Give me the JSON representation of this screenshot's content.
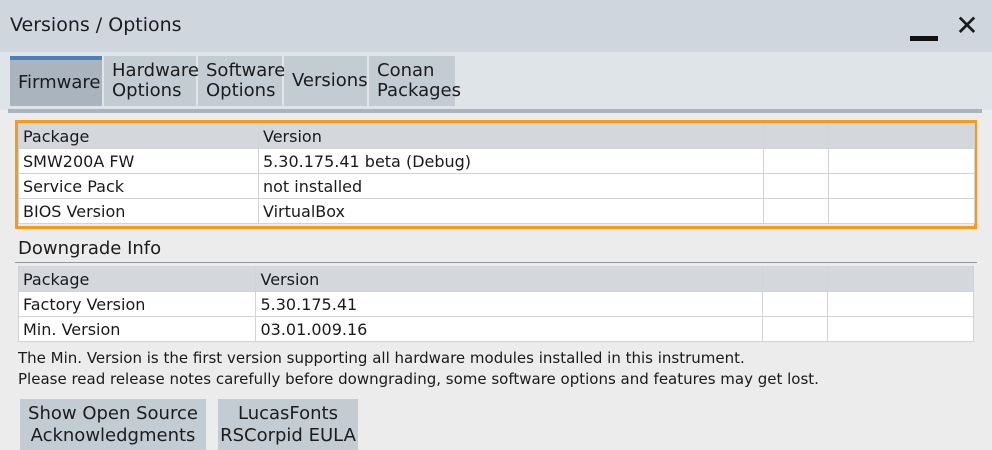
{
  "window": {
    "title": "Versions / Options",
    "close_glyph": "✕"
  },
  "tabs": [
    {
      "line1": "Firmware",
      "line2": "",
      "active": true
    },
    {
      "line1": "Hardware",
      "line2": "Options",
      "active": false
    },
    {
      "line1": "Software",
      "line2": "Options",
      "active": false
    },
    {
      "line1": "Versions",
      "line2": "",
      "active": false
    },
    {
      "line1": "Conan",
      "line2": "Packages",
      "active": false
    }
  ],
  "firmware_table": {
    "headers": [
      "Package",
      "Version",
      "",
      ""
    ],
    "rows": [
      [
        "SMW200A FW",
        "5.30.175.41 beta (Debug)",
        "",
        ""
      ],
      [
        "Service Pack",
        "not installed",
        "",
        ""
      ],
      [
        "BIOS Version",
        "VirtualBox",
        "",
        ""
      ]
    ]
  },
  "downgrade": {
    "title": "Downgrade Info",
    "headers": [
      "Package",
      "Version",
      "",
      ""
    ],
    "rows": [
      [
        "Factory Version",
        "5.30.175.41",
        "",
        ""
      ],
      [
        "Min. Version",
        "03.01.009.16",
        "",
        ""
      ]
    ]
  },
  "notes": [
    "The Min. Version is the first version supporting all hardware modules installed in this instrument.",
    "Please read release notes carefully before downgrading, some software options and features may get lost."
  ],
  "buttons": [
    {
      "line1": "Show Open Source",
      "line2": "Acknowledgments"
    },
    {
      "line1": "LucasFonts",
      "line2": "RSCorpid EULA"
    }
  ],
  "colors": {
    "highlight": "#f29b1d",
    "active_tab_accent": "#4d7fb6",
    "titlebar": "#cfd6de"
  }
}
